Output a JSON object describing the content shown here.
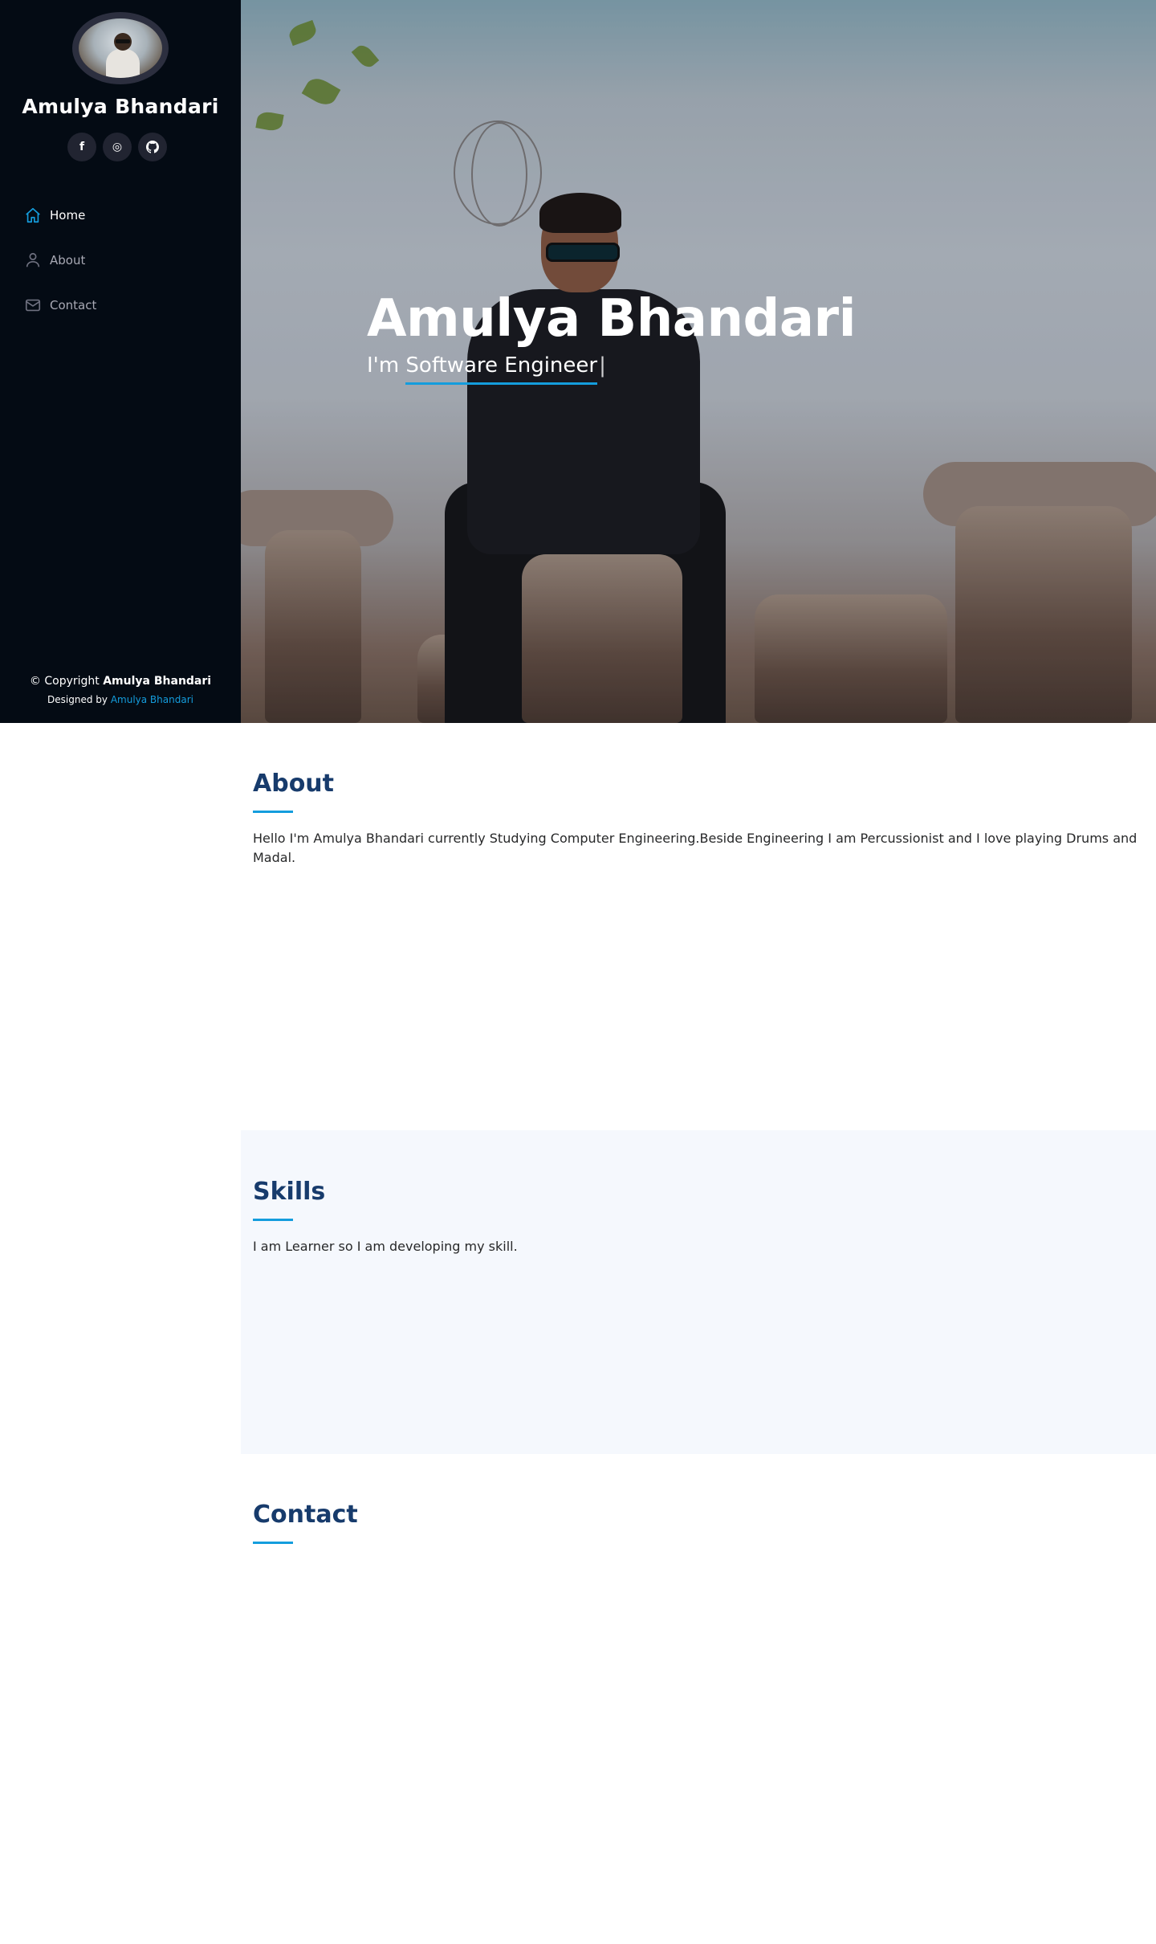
{
  "sidebar": {
    "name": "Amulya Bhandari",
    "socials": [
      {
        "icon": "facebook-icon",
        "glyph": "f"
      },
      {
        "icon": "instagram-icon",
        "glyph": "◎"
      },
      {
        "icon": "github-icon",
        "glyph": "●"
      }
    ],
    "nav": [
      {
        "label": "Home",
        "icon": "home-icon",
        "active": true
      },
      {
        "label": "About",
        "icon": "person-icon",
        "active": false
      },
      {
        "label": "Contact",
        "icon": "envelope-icon",
        "active": false
      }
    ],
    "footer": {
      "copyright_prefix": "© Copyright",
      "copyright_name": "Amulya Bhandari",
      "designed_prefix": "Designed by",
      "designed_link": "Amulya Bhandari"
    }
  },
  "hero": {
    "title": "Amulya Bhandari",
    "subtitle_prefix": "I'm",
    "subtitle_typed": "Software Engineer",
    "cursor": "|"
  },
  "about": {
    "title": "About",
    "text": "Hello I'm Amulya Bhandari currently Studying Computer Engineering.Beside Engineering I am Percussionist and I love playing Drums and Madal."
  },
  "skills": {
    "title": "Skills",
    "text": "I am Learner so I am developing my skill."
  },
  "contact": {
    "title": "Contact"
  },
  "colors": {
    "accent": "#149ddd",
    "sidebar_bg": "#040b14",
    "heading": "#173b6c",
    "skills_bg": "#f5f8fd"
  }
}
